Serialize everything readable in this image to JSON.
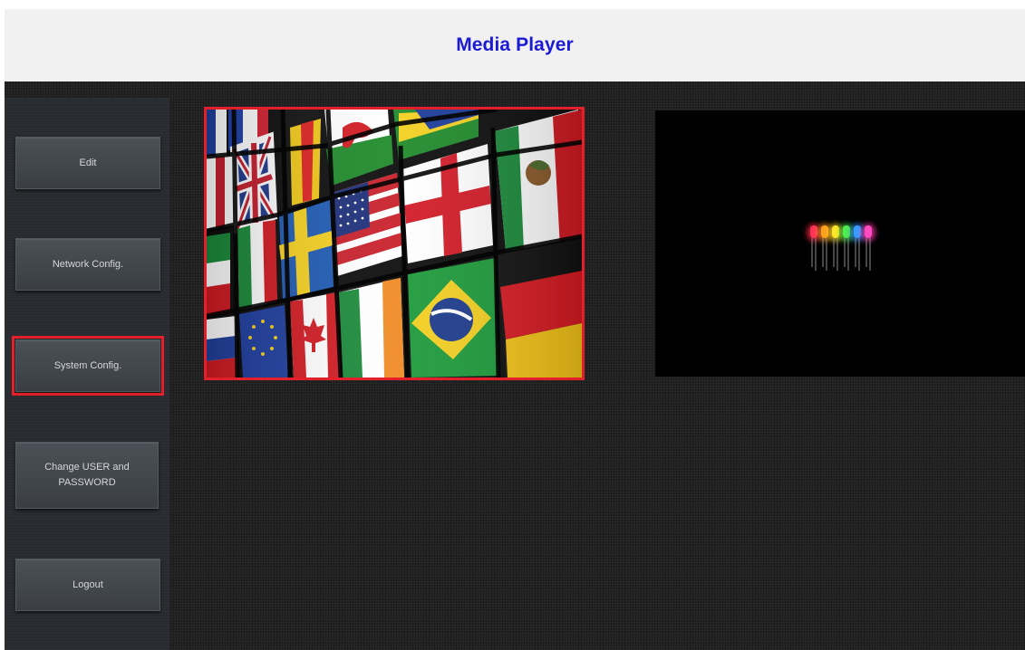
{
  "header": {
    "title": "Media Player"
  },
  "sidebar": {
    "items": [
      {
        "label": "Edit"
      },
      {
        "label": "Network Config."
      },
      {
        "label": "System Config."
      },
      {
        "label": "Change USER and PASSWORD"
      },
      {
        "label": "Logout"
      }
    ],
    "selected_index": 2
  },
  "tiles": [
    {
      "name": "world-flags-thumbnail",
      "selected": true
    },
    {
      "name": "led-lights-thumbnail",
      "selected": false
    }
  ],
  "colors": {
    "title": "#1b1bd6",
    "selection_border": "#e3202a",
    "header_bg": "#f1f1f1"
  }
}
